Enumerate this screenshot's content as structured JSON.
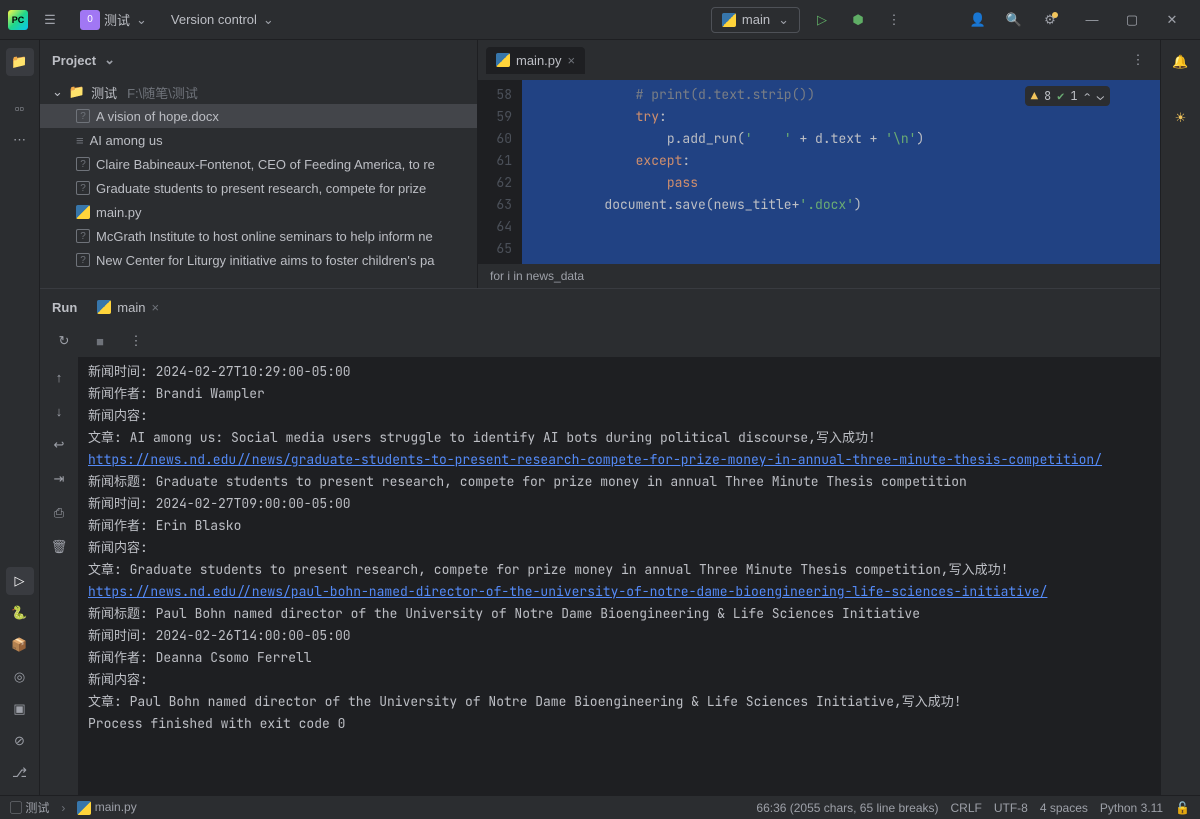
{
  "titlebar": {
    "project_badge": "0",
    "project_name": "测试",
    "vcs_menu": "Version control",
    "run_config": "main"
  },
  "project_panel": {
    "title": "Project",
    "root_name": "测试",
    "root_path": "F:\\随笔\\测试",
    "files": [
      {
        "name": "A vision of hope.docx",
        "type": "doc",
        "selected": true
      },
      {
        "name": "AI among us",
        "type": "txt",
        "selected": false
      },
      {
        "name": "Claire Babineaux-Fontenot, CEO of Feeding America, to re",
        "type": "doc",
        "selected": false
      },
      {
        "name": "Graduate students to present research, compete for prize",
        "type": "doc",
        "selected": false
      },
      {
        "name": "main.py",
        "type": "py",
        "selected": false
      },
      {
        "name": "McGrath Institute to host online seminars to help inform ne",
        "type": "doc",
        "selected": false
      },
      {
        "name": "New Center for Liturgy initiative aims to foster children's pa",
        "type": "doc",
        "selected": false
      }
    ]
  },
  "editor": {
    "tab_name": "main.py",
    "gutter": [
      "58",
      "59",
      "60",
      "61",
      "62",
      "63",
      "64",
      "65"
    ],
    "lines": [
      {
        "indent": 3,
        "parts": [
          {
            "t": "# print(d.text.strip())",
            "c": "tok-comment"
          }
        ]
      },
      {
        "indent": 3,
        "parts": [
          {
            "t": "try",
            "c": "tok-keyword"
          },
          {
            "t": ":",
            "c": "tok-ident"
          }
        ]
      },
      {
        "indent": 4,
        "parts": [
          {
            "t": "p.add_run(",
            "c": "tok-ident"
          },
          {
            "t": "'    '",
            "c": "tok-string"
          },
          {
            "t": " + d.text + ",
            "c": "tok-ident"
          },
          {
            "t": "'\\n'",
            "c": "tok-string"
          },
          {
            "t": ")",
            "c": "tok-ident"
          }
        ]
      },
      {
        "indent": 3,
        "parts": [
          {
            "t": "except",
            "c": "tok-keyword"
          },
          {
            "t": ":",
            "c": "tok-ident"
          }
        ]
      },
      {
        "indent": 4,
        "parts": [
          {
            "t": "pass",
            "c": "tok-keyword"
          }
        ]
      },
      {
        "indent": 0,
        "parts": []
      },
      {
        "indent": 2,
        "parts": [
          {
            "t": "document.save(news_title+",
            "c": "tok-ident"
          },
          {
            "t": "'.docx'",
            "c": "tok-string"
          },
          {
            "t": ")",
            "c": "tok-ident"
          }
        ]
      },
      {
        "indent": 0,
        "parts": []
      }
    ],
    "inspections": {
      "errors": "8",
      "warnings": "1"
    },
    "breadcrumb": "for i in news_data"
  },
  "run_panel": {
    "title": "Run",
    "tab_name": "main",
    "output": [
      {
        "text": "新闻时间: 2024-02-27T10:29:00-05:00"
      },
      {
        "text": "新闻作者: Brandi Wampler"
      },
      {
        "text": "新闻内容:"
      },
      {
        "text": "文章: AI among us: Social media users struggle to identify AI bots during political discourse,写入成功!"
      },
      {
        "text": "https://news.nd.edu//news/graduate-students-to-present-research-compete-for-prize-money-in-annual-three-minute-thesis-competition/",
        "link": true
      },
      {
        "text": "新闻标题: Graduate students to present research, compete for prize money in annual Three Minute Thesis competition"
      },
      {
        "text": "新闻时间: 2024-02-27T09:00:00-05:00"
      },
      {
        "text": "新闻作者: Erin Blasko"
      },
      {
        "text": "新闻内容:"
      },
      {
        "text": "文章: Graduate students to present research, compete for prize money in annual Three Minute Thesis competition,写入成功!"
      },
      {
        "text": "https://news.nd.edu//news/paul-bohn-named-director-of-the-university-of-notre-dame-bioengineering-life-sciences-initiative/",
        "link": true
      },
      {
        "text": "新闻标题: Paul Bohn named director of the University of Notre Dame Bioengineering & Life Sciences Initiative"
      },
      {
        "text": "新闻时间: 2024-02-26T14:00:00-05:00"
      },
      {
        "text": "新闻作者: Deanna Csomo Ferrell"
      },
      {
        "text": "新闻内容:"
      },
      {
        "text": "文章: Paul Bohn named director of the University of Notre Dame Bioengineering & Life Sciences Initiative,写入成功!"
      },
      {
        "text": ""
      },
      {
        "text": "Process finished with exit code 0"
      }
    ]
  },
  "statusbar": {
    "breadcrumb_project": "测试",
    "breadcrumb_file": "main.py",
    "caret": "66:36 (2055 chars, 65 line breaks)",
    "line_sep": "CRLF",
    "encoding": "UTF-8",
    "indent": "4 spaces",
    "interpreter": "Python 3.11"
  }
}
